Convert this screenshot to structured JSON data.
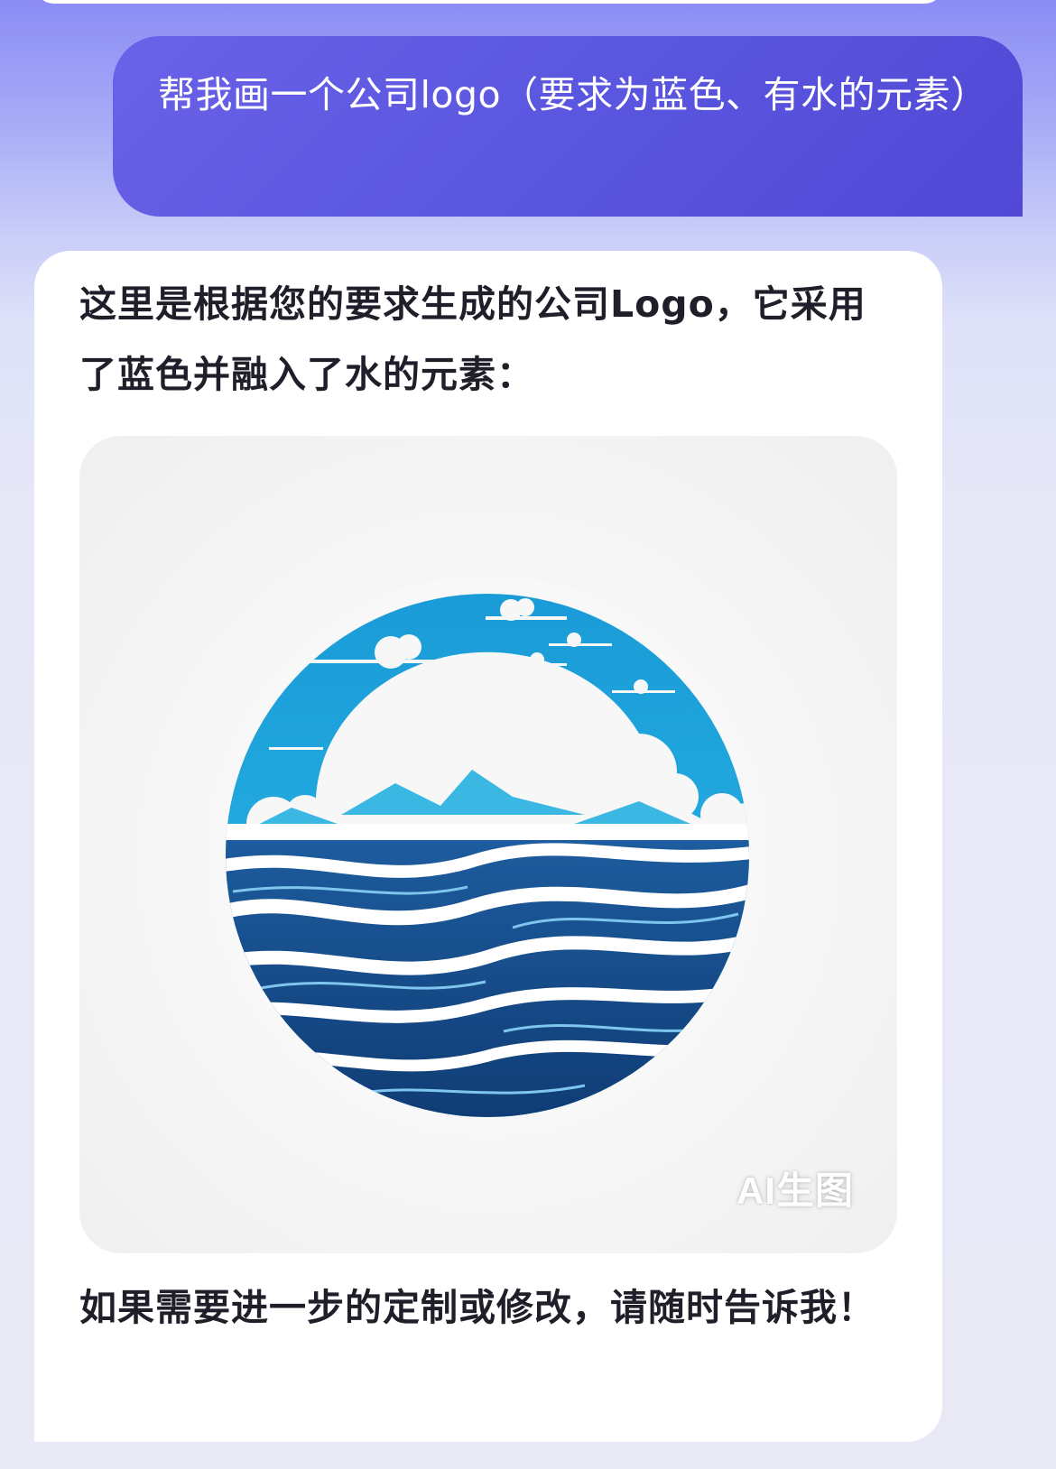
{
  "conversation": {
    "user_message": "帮我画一个公司logo（要求为蓝色、有水的元素）",
    "assistant_intro": "这里是根据您的要求生成的公司Logo，它采用了蓝色并融入了水的元素：",
    "assistant_outro": "如果需要进一步的定制或修改，请随时告诉我！"
  },
  "generated_image": {
    "subject": "circular-water-logo",
    "watermark": "AI生图"
  },
  "colors": {
    "user_bubble": "#5a56df",
    "assistant_bubble": "#ffffff",
    "sky_blue": "#1fa9de",
    "ocean_navy": "#123f7a"
  }
}
